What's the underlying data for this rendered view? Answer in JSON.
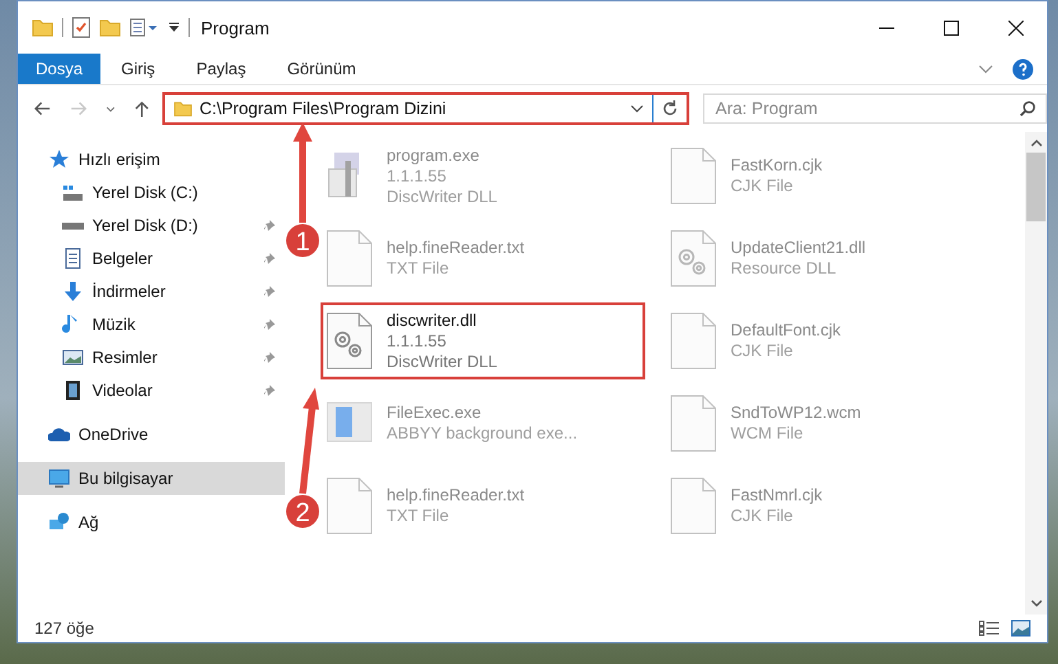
{
  "window": {
    "title": "Program"
  },
  "ribbon_tabs": [
    {
      "label": "Dosya",
      "selected": true
    },
    {
      "label": "Giriş",
      "selected": false
    },
    {
      "label": "Paylaş",
      "selected": false
    },
    {
      "label": "Görünüm",
      "selected": false
    }
  ],
  "address_bar": {
    "path": "C:\\Program Files\\Program Dizini",
    "highlighted": true
  },
  "search": {
    "placeholder": "Ara: Program"
  },
  "sidebar": {
    "items": [
      {
        "label": "Hızlı erişim",
        "kind": "star",
        "level2": false,
        "pinned": false,
        "selected": false
      },
      {
        "label": "Yerel Disk (C:)",
        "kind": "drive-c",
        "level2": true,
        "pinned": false,
        "selected": false
      },
      {
        "label": "Yerel Disk (D:)",
        "kind": "drive",
        "level2": true,
        "pinned": true,
        "selected": false
      },
      {
        "label": "Belgeler",
        "kind": "document",
        "level2": true,
        "pinned": true,
        "selected": false
      },
      {
        "label": "İndirmeler",
        "kind": "download",
        "level2": true,
        "pinned": true,
        "selected": false
      },
      {
        "label": "Müzik",
        "kind": "music",
        "level2": true,
        "pinned": true,
        "selected": false
      },
      {
        "label": "Resimler",
        "kind": "pictures",
        "level2": true,
        "pinned": true,
        "selected": false
      },
      {
        "label": "Videolar",
        "kind": "video",
        "level2": true,
        "pinned": true,
        "selected": false
      },
      {
        "label": "OneDrive",
        "kind": "cloud",
        "level2": false,
        "pinned": false,
        "selected": false,
        "gap": true
      },
      {
        "label": "Bu bilgisayar",
        "kind": "computer",
        "level2": false,
        "pinned": false,
        "selected": true,
        "gap": true
      },
      {
        "label": "Ağ",
        "kind": "network",
        "level2": false,
        "pinned": false,
        "selected": false,
        "gap": true
      }
    ]
  },
  "files": {
    "columns": [
      [
        {
          "name": "program.exe",
          "details": [
            "1.1.1.55",
            "DiscWriter DLL"
          ],
          "kind": "installer",
          "faded": true,
          "highlighted": false
        },
        {
          "name": "help.fineReader.txt",
          "details": [
            "TXT File"
          ],
          "kind": "blank",
          "faded": true,
          "highlighted": false
        },
        {
          "name": "discwriter.dll",
          "details": [
            "1.1.1.55",
            "DiscWriter DLL"
          ],
          "kind": "gears",
          "faded": false,
          "highlighted": true
        },
        {
          "name": "FileExec.exe",
          "details": [
            "ABBYY background exe..."
          ],
          "kind": "app",
          "faded": true,
          "highlighted": false
        },
        {
          "name": "help.fineReader.txt",
          "details": [
            "TXT File"
          ],
          "kind": "blank",
          "faded": true,
          "highlighted": false
        }
      ],
      [
        {
          "name": "FastKorn.cjk",
          "details": [
            "CJK File"
          ],
          "kind": "blank",
          "faded": true,
          "highlighted": false
        },
        {
          "name": "UpdateClient21.dll",
          "details": [
            "Resource DLL"
          ],
          "kind": "gears",
          "faded": true,
          "highlighted": false
        },
        {
          "name": "DefaultFont.cjk",
          "details": [
            "CJK File"
          ],
          "kind": "blank",
          "faded": true,
          "highlighted": false
        },
        {
          "name": "SndToWP12.wcm",
          "details": [
            "WCM File"
          ],
          "kind": "blank",
          "faded": true,
          "highlighted": false
        },
        {
          "name": "FastNmrl.cjk",
          "details": [
            "CJK File"
          ],
          "kind": "blank",
          "faded": true,
          "highlighted": false
        }
      ]
    ]
  },
  "status_bar": {
    "count": "127 öğe"
  },
  "annotations": [
    {
      "number": "1"
    },
    {
      "number": "2"
    }
  ]
}
